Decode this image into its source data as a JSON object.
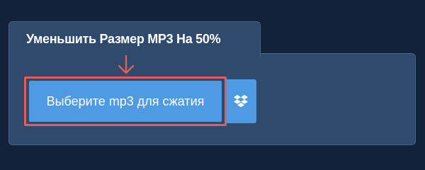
{
  "panel": {
    "title": "Уменьшить Размер MP3 На 50%"
  },
  "upload": {
    "choose_label": "Выберите mp3 для сжатия",
    "dropbox_icon": "dropbox-icon",
    "arrow_icon": "arrow-down-icon"
  },
  "colors": {
    "page_background": "#12223a",
    "panel_background": "#2f4a6c",
    "panel_border": "#4a6488",
    "button_blue": "#4f9be3",
    "highlight_red": "#e45d58"
  }
}
